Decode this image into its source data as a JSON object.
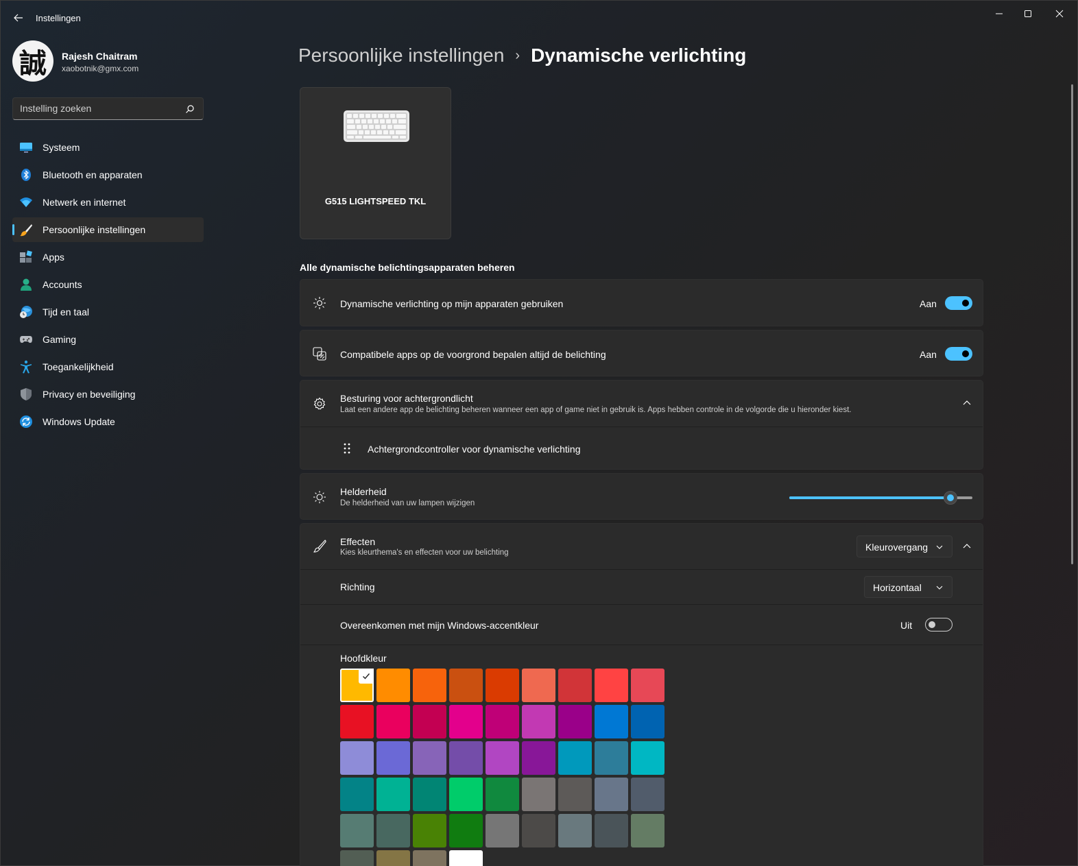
{
  "window": {
    "title": "Instellingen"
  },
  "profile": {
    "name": "Rajesh Chaitram",
    "email": "xaobotnik@gmx.com",
    "avatar_glyph": "誠"
  },
  "search": {
    "placeholder": "Instelling zoeken"
  },
  "nav": {
    "items": [
      {
        "label": "Systeem",
        "icon": "monitor-icon"
      },
      {
        "label": "Bluetooth en apparaten",
        "icon": "bluetooth-icon"
      },
      {
        "label": "Netwerk en internet",
        "icon": "wifi-icon"
      },
      {
        "label": "Persoonlijke instellingen",
        "icon": "paintbrush-icon",
        "active": true
      },
      {
        "label": "Apps",
        "icon": "apps-icon"
      },
      {
        "label": "Accounts",
        "icon": "person-icon"
      },
      {
        "label": "Tijd en taal",
        "icon": "globe-clock-icon"
      },
      {
        "label": "Gaming",
        "icon": "gamepad-icon"
      },
      {
        "label": "Toegankelijkheid",
        "icon": "accessibility-icon"
      },
      {
        "label": "Privacy en beveiliging",
        "icon": "shield-icon"
      },
      {
        "label": "Windows Update",
        "icon": "update-icon"
      }
    ]
  },
  "breadcrumb": {
    "parent": "Persoonlijke instellingen",
    "separator": "›",
    "current": "Dynamische verlichting"
  },
  "device": {
    "name": "G515 LIGHTSPEED TKL",
    "icon": "keyboard-icon"
  },
  "section": {
    "title": "Alle dynamische belichtingsapparaten beheren"
  },
  "settings": {
    "use_dynamic": {
      "title": "Dynamische verlichting op mijn apparaten gebruiken",
      "state": "Aan",
      "on": true
    },
    "foreground_apps": {
      "title": "Compatibele apps op de voorgrond bepalen altijd de belichting",
      "state": "Aan",
      "on": true
    },
    "background": {
      "title": "Besturing voor achtergrondlicht",
      "subtitle": "Laat een andere app de belichting beheren wanneer een app of game niet in gebruik is. Apps hebben controle in de volgorde die u hieronder kiest.",
      "controller": "Achtergrondcontroller voor dynamische verlichting"
    },
    "brightness": {
      "title": "Helderheid",
      "subtitle": "De helderheid van uw lampen wijzigen",
      "value_fraction": 0.88
    },
    "effects": {
      "title": "Effecten",
      "subtitle": "Kies kleurthema's en effecten voor uw belichting",
      "selected": "Kleurovergang",
      "direction_label": "Richting",
      "direction_value": "Horizontaal",
      "accent_match": "Overeenkomen met mijn Windows-accentkleur",
      "accent_state": "Uit",
      "accent_on": false,
      "main_color_label": "Hoofdkleur"
    }
  },
  "colors": {
    "accent": "#4cc2ff",
    "swatches": [
      [
        "#ffb900",
        "#ff8c00",
        "#f7630c",
        "#ca5010",
        "#da3b01",
        "#ef6950",
        "#d13438",
        "#ff4343",
        "#e74856"
      ],
      [
        "#e81123",
        "#ea005e",
        "#c30052",
        "#e3008c",
        "#bf0077",
        "#c239b3",
        "#9a0089",
        "#0078d4",
        "#0063b1"
      ],
      [
        "#8e8cd8",
        "#6b69d6",
        "#8764b8",
        "#744da9",
        "#b146c2",
        "#881798",
        "#0099bc",
        "#2d7d9a",
        "#00b7c3"
      ],
      [
        "#038387",
        "#00b294",
        "#018574",
        "#00cc6a",
        "#10893e",
        "#7a7574",
        "#5d5a58",
        "#68768a",
        "#515c6b"
      ],
      [
        "#567c73",
        "#486860",
        "#498205",
        "#107c10",
        "#767676",
        "#4c4a48",
        "#69797e",
        "#4a5459",
        "#647c64"
      ],
      [
        "#525e54",
        "#847545",
        "#7e735f",
        "#ffffff"
      ]
    ],
    "selected_swatch": "#ffb900"
  }
}
